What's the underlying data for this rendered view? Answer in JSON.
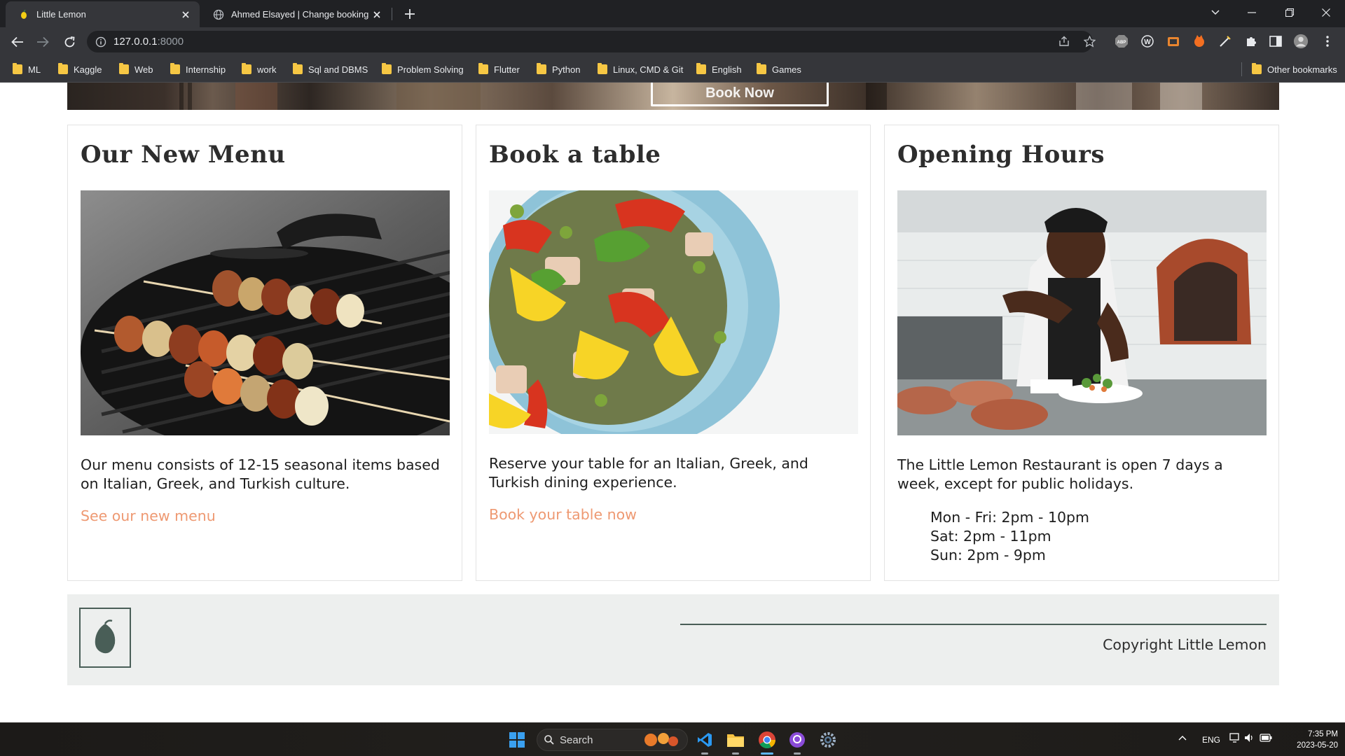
{
  "browser": {
    "tabs": [
      {
        "title": "Little Lemon",
        "active": true
      },
      {
        "title": "Ahmed Elsayed | Change booking |",
        "active": false
      }
    ],
    "url_host": "127.0.0.1",
    "url_port": ":8000",
    "bookmarks": [
      "ML",
      "Kaggle",
      "Web",
      "Internship",
      "work",
      "Sql and DBMS",
      "Problem Solving",
      "Flutter",
      "Python",
      "Linux, CMD & Git",
      "English",
      "Games"
    ],
    "other_bookmarks": "Other bookmarks"
  },
  "hero": {
    "button_label": "Book Now"
  },
  "cards": [
    {
      "title": "Our New Menu",
      "image": "grilled-skewers-image",
      "description": "Our menu consists of 12-15 seasonal items based on Italian, Greek, and Turkish culture.",
      "link": "See our new menu"
    },
    {
      "title": "Book a table",
      "image": "salad-plate-image",
      "description": "Reserve your table for an Italian, Greek, and Turkish dining experience.",
      "link": "Book your table now"
    },
    {
      "title": "Opening Hours",
      "image": "chef-kitchen-image",
      "description": "The Little Lemon Restaurant is open 7 days a week, except for public holidays.",
      "hours": [
        "Mon - Fri: 2pm - 10pm",
        "Sat: 2pm - 11pm",
        "Sun: 2pm - 9pm"
      ]
    }
  ],
  "footer": {
    "copyright": "Copyright Little Lemon"
  },
  "taskbar": {
    "search_label": "Search",
    "language": "ENG",
    "time": "7:35 PM",
    "date": "2023-05-20"
  },
  "colors": {
    "accent_link": "#ee9972",
    "footer_bg": "#edefee",
    "brand_green": "#495e57",
    "chrome_dark": "#202124",
    "chrome_toolbar": "#35363a"
  }
}
